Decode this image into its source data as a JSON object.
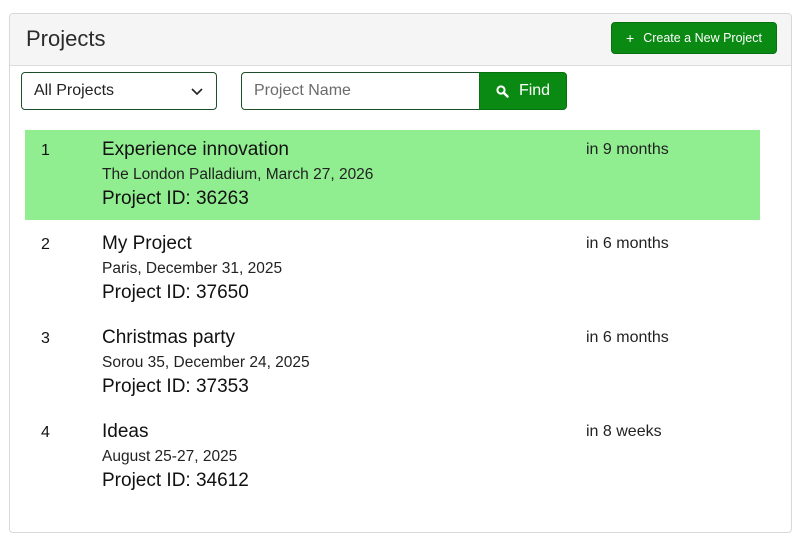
{
  "header": {
    "title": "Projects",
    "create_label": "Create a New Project",
    "create_icon": "plus-icon"
  },
  "filters": {
    "select_value": "All Projects",
    "search_placeholder": "Project Name",
    "search_value": "",
    "find_label": "Find"
  },
  "colors": {
    "accent": "#0b8a13",
    "highlight": "#90ee90"
  },
  "projects": [
    {
      "index": "1",
      "name": "Experience innovation",
      "place": "The London Palladium, March 27, 2026",
      "pid": "Project ID: 36263",
      "when": "in 9 months"
    },
    {
      "index": "2",
      "name": "My Project",
      "place": "Paris, December 31, 2025",
      "pid": "Project ID: 37650",
      "when": "in 6 months"
    },
    {
      "index": "3",
      "name": "Christmas party",
      "place": "Sorou 35, December 24, 2025",
      "pid": "Project ID: 37353",
      "when": "in 6 months"
    },
    {
      "index": "4",
      "name": "Ideas",
      "place": "August 25-27, 2025",
      "pid": "Project ID: 34612",
      "when": "in 8 weeks"
    }
  ]
}
